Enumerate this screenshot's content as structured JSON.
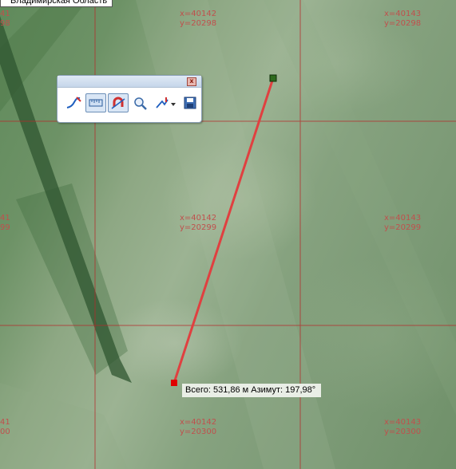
{
  "map": {
    "region_label": "Владимирская Область",
    "grid_labels": [
      {
        "id": "x40142-y20298",
        "text": "x=40142\ny=20298"
      },
      {
        "id": "x40143-y20298",
        "text": "x=40143\ny=20298"
      },
      {
        "id": "x40141-y20298",
        "text": "41\n98"
      },
      {
        "id": "x40142-y20299",
        "text": "x=40142\ny=20299"
      },
      {
        "id": "x40143-y20299",
        "text": "x=40143\ny=20299"
      },
      {
        "id": "x40141-y20299",
        "text": "41\n99"
      },
      {
        "id": "x40142-y20300",
        "text": "x=40142\ny=20300"
      },
      {
        "id": "x40143-y20300",
        "text": "x=40143\ny=20300"
      },
      {
        "id": "x40141-y20300",
        "text": "41\n00"
      }
    ],
    "grid_color": "#b52a2a",
    "measure_line_color": "#e04040",
    "start_marker_color": "#2e6b1e",
    "end_marker_color": "#e00000"
  },
  "toolbar": {
    "tools": [
      {
        "name": "draw-line-tool-icon"
      },
      {
        "name": "ruler-tool-icon",
        "active": true
      },
      {
        "name": "magnet-snap-tool-icon",
        "active": true
      },
      {
        "name": "zoom-tool-icon"
      },
      {
        "name": "elevation-tool-icon"
      },
      {
        "name": "save-tool-icon"
      }
    ],
    "close_label": "x"
  },
  "measurement": {
    "text": "Всего: 531,86 м Азимут: 197,98°"
  }
}
